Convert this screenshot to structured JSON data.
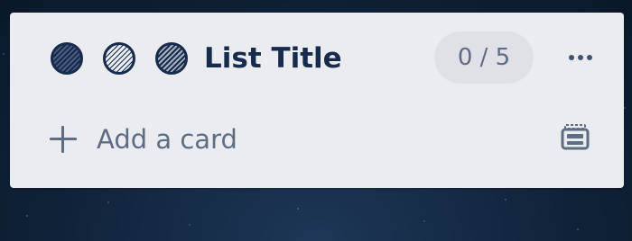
{
  "list": {
    "title": "List Title",
    "count": "0 / 5",
    "label_dots": [
      {
        "name": "label-dot-dark",
        "color": "#172b4d",
        "pattern": "dense-stripes"
      },
      {
        "name": "label-dot-light",
        "color": "#172b4d",
        "pattern": "light-stripes"
      },
      {
        "name": "label-dot-medium",
        "color": "#172b4d",
        "pattern": "medium-stripes"
      }
    ],
    "menu_icon": "more-horizontal-icon",
    "add_card": {
      "icon": "plus-icon",
      "label": "Add a card"
    },
    "template_icon": "card-template-icon"
  },
  "colors": {
    "list_background": "#ebecf0",
    "title_text": "#172b4d",
    "muted_text": "#5e6c84",
    "badge_background": "#dfe1e6",
    "board_background": "#10233a"
  }
}
